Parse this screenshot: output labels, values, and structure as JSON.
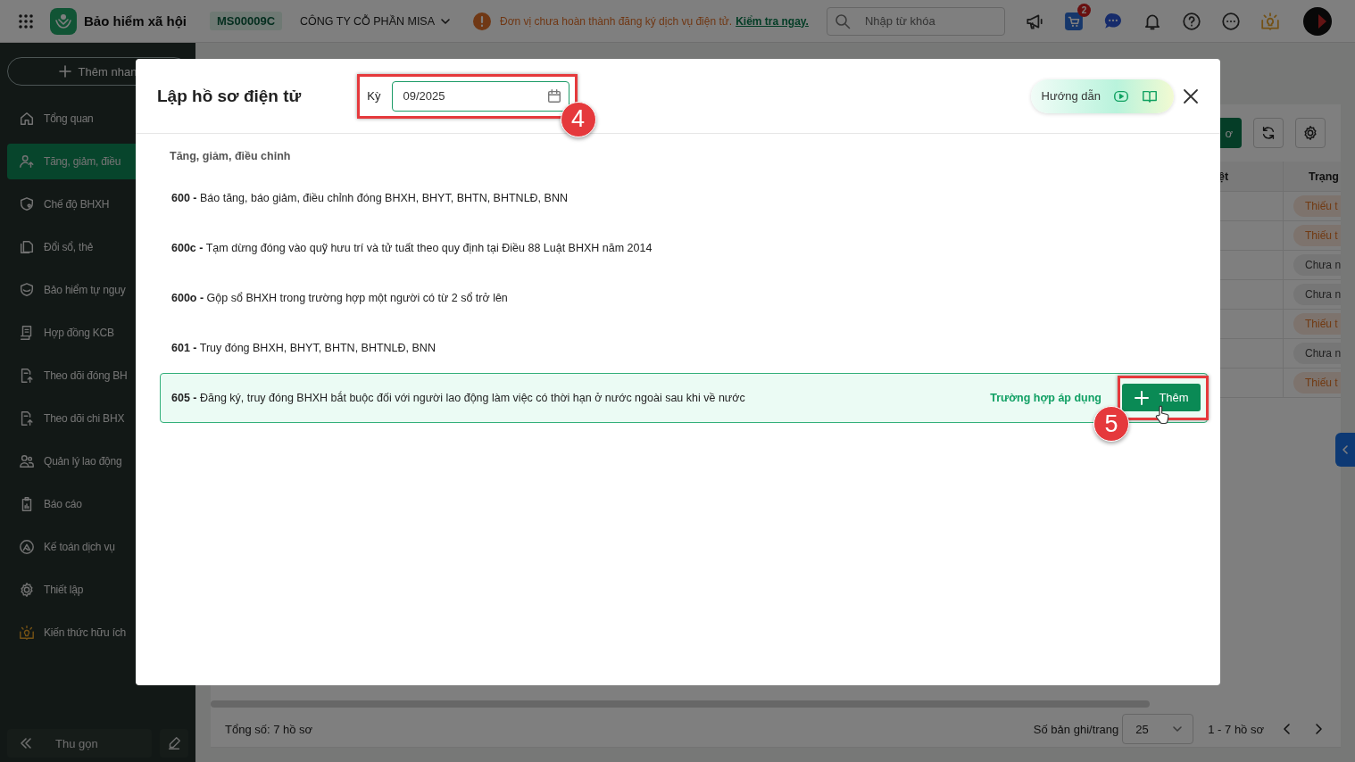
{
  "topbar": {
    "app_title": "Bảo hiểm xã hội",
    "company_code": "MS00009C",
    "company_name": "CÔNG TY CỖ PHẦN MISA",
    "warning": "Đơn vị chưa hoàn thành đăng ký dịch vụ điện tử.",
    "warning_link": "Kiểm tra ngay.",
    "search": {
      "placeholder": "Nhập từ khóa"
    },
    "cart_badge": "2"
  },
  "sidebar": {
    "quick_add": "Thêm nhan",
    "items": [
      {
        "label": "Tổng quan",
        "selected": false
      },
      {
        "label": "Tăng, giảm, điều",
        "selected": true
      },
      {
        "label": "Chế độ BHXH",
        "selected": false
      },
      {
        "label": "Đổi sổ, thẻ",
        "selected": false
      },
      {
        "label": "Bảo hiểm tự nguy",
        "selected": false
      },
      {
        "label": "Hợp đồng KCB",
        "selected": false
      },
      {
        "label": "Theo dõi đóng BH",
        "selected": false
      },
      {
        "label": "Theo dõi chi BHX",
        "selected": false
      },
      {
        "label": "Quản lý lao động",
        "selected": false
      },
      {
        "label": "Báo cáo",
        "selected": false
      },
      {
        "label": "Kế toán dịch vụ",
        "selected": false
      },
      {
        "label": "Thiết lập",
        "selected": false
      },
      {
        "label": "Kiến thức hữu ích",
        "selected": false
      }
    ],
    "collapse": "Thu gọn"
  },
  "page": {
    "toolbar_button": "ơ",
    "columns": [
      "ệt",
      "Trạng"
    ],
    "rows": [
      {
        "status": "Thiếu t",
        "kind": "missing"
      },
      {
        "status": "Thiếu t",
        "kind": "missing"
      },
      {
        "status": "Chưa n",
        "kind": "pending"
      },
      {
        "status": "Chưa n",
        "kind": "pending"
      },
      {
        "status": "Thiếu t",
        "kind": "missing"
      },
      {
        "status": "Chưa n",
        "kind": "pending"
      },
      {
        "status": "Thiếu t",
        "kind": "missing"
      }
    ],
    "total": "Tổng số: 7 hồ sơ",
    "page_size_label": "Số bản ghi/trang",
    "page_size": "25",
    "range": "1 - 7 hồ sơ"
  },
  "dialog": {
    "title": "Lập hồ sơ điện tử",
    "period": {
      "label": "Kỳ",
      "value": "09/2025",
      "callout": "4"
    },
    "guide": "Hướng dẫn",
    "section": "Tăng, giảm, điều chỉnh",
    "forms": [
      {
        "text": "**600 -** Báo tăng, báo giảm, điều chỉnh đóng BHXH, BHYT, BHTN, BHTNLĐ, BNN",
        "selected": false
      },
      {
        "text": "**600c -** Tạm dừng đóng vào quỹ hưu trí và tử tuất theo quy định tại Điều 88 Luật BHXH năm 2014",
        "selected": false
      },
      {
        "text": "**600o -** Gộp sổ BHXH trong trường hợp một người có từ 2 sổ trở lên",
        "selected": false
      },
      {
        "text": "**601 -** Truy đóng BHXH, BHYT, BHTN, BHTNLĐ, BNN",
        "selected": false
      },
      {
        "text": "**605 -** Đăng ký, truy đóng BHXH bắt buộc đối với người lao động làm việc có thời hạn ở nước ngoài sau khi về nước",
        "selected": true,
        "link": "Trường hợp áp dụng",
        "button": "Thêm",
        "callout": "5"
      }
    ]
  }
}
